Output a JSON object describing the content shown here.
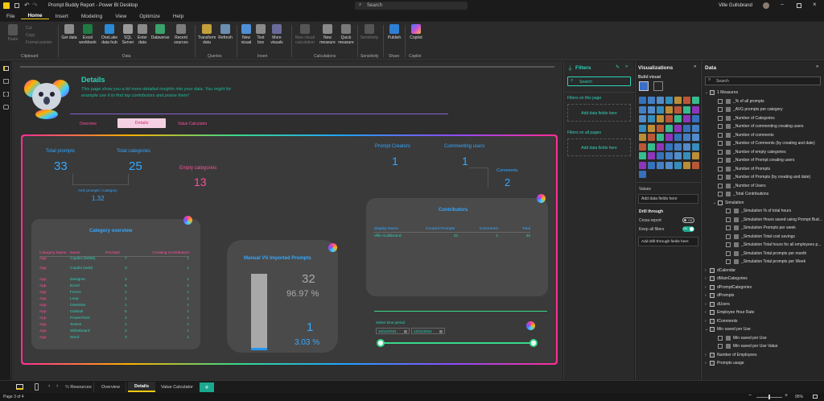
{
  "titlebar": {
    "title": "Prompt Buddy Report - Power BI Desktop",
    "search": "Search",
    "user": "Ville Gullsbrand"
  },
  "menu": [
    "File",
    "Home",
    "Insert",
    "Modeling",
    "View",
    "Optimize",
    "Help"
  ],
  "ribbon": {
    "clipboard": {
      "paste": "Paste",
      "cut": "Cut",
      "copy": "Copy",
      "format_painter": "Format painter",
      "label": "Clipboard"
    },
    "data": {
      "buttons": [
        "Get data",
        "Excel workbook",
        "OneLake data hub",
        "SQL Server",
        "Enter data",
        "Dataverse",
        "Recent sources"
      ],
      "label": "Data"
    },
    "queries": {
      "buttons": [
        "Transform data",
        "Refresh"
      ],
      "label": "Queries"
    },
    "insert": {
      "buttons": [
        "New visual",
        "Text box",
        "More visuals"
      ],
      "label": "Insert"
    },
    "calculations": {
      "buttons": [
        "New visual calculation",
        "New measure",
        "Quick measure"
      ],
      "label": "Calculations"
    },
    "sensitivity": {
      "buttons": [
        "Sensitivity"
      ],
      "label": "Sensitivity"
    },
    "share": {
      "buttons": [
        "Publish"
      ],
      "label": "Share"
    },
    "copilot": {
      "buttons": [
        "Copilot"
      ],
      "label": "Copilot"
    }
  },
  "report": {
    "title": "Details",
    "subtitle": "This page show you a bit more detailed insights into your data. You might for example use it to find top contributors and praise them!",
    "nav": [
      "Overview",
      "Details",
      "Value Calculator"
    ],
    "kpis": {
      "total_prompts_label": "Total prompts",
      "total_prompts": "33",
      "total_categories_label": "Total categories",
      "total_categories": "25",
      "empty_categories_label": "Empty categories",
      "empty_categories": "13",
      "avg_label": "AVG prompts / Category",
      "avg": "1.32",
      "prompt_creators_label": "Prompt Creators",
      "prompt_creators": "1",
      "commenting_users_label": "Commenting users",
      "commenting_users": "1",
      "comments_label": "Comments",
      "comments": "2"
    },
    "category_overview": {
      "title": "Category overview",
      "headers": [
        "Category Name",
        "Name",
        "Prompts",
        "Creating Contributors"
      ],
      "rows": [
        [
          "App",
          "Copilot (M365)",
          "7",
          "1"
        ],
        [
          "App",
          "Copilot (web)",
          "3",
          "1"
        ],
        [
          "App",
          "Designer",
          "2",
          "1"
        ],
        [
          "App",
          "Excel",
          "5",
          "1"
        ],
        [
          "App",
          "Forms",
          "1",
          "1"
        ],
        [
          "App",
          "Loop",
          "1",
          "1"
        ],
        [
          "App",
          "OneNote",
          "1",
          "1"
        ],
        [
          "App",
          "Outlook",
          "5",
          "1"
        ],
        [
          "App",
          "PowerPoint",
          "2",
          "1"
        ],
        [
          "App",
          "Teams",
          "1",
          "1"
        ],
        [
          "App",
          "Whiteboard",
          "2",
          "1"
        ],
        [
          "App",
          "Word",
          "3",
          "1"
        ]
      ]
    },
    "manual_vs_imported": {
      "title": "Manual VS Imported Prompts",
      "manual_count": "32",
      "manual_pct": "96.97 %",
      "imported_count": "1",
      "imported_pct": "3.03 %",
      "imported_fraction": 0.0303
    },
    "contributors": {
      "title": "Contributors",
      "headers": [
        "Display Name",
        "Created Prompts",
        "Comments",
        "Total"
      ],
      "rows": [
        [
          "Ville Gullsbrand",
          "33",
          "2",
          "35"
        ]
      ]
    },
    "time_period": {
      "label": "Select time period",
      "start": "10/24/2024",
      "end": "12/31/2024"
    }
  },
  "filters": {
    "title": "Filters",
    "search": "Search",
    "on_page": "Filters on this page",
    "add_fields": "Add data fields here",
    "on_all_pages": "Filters on all pages"
  },
  "visualizations": {
    "title": "Visualizations",
    "build": "Build visual",
    "values": "Values",
    "add_fields": "Add data fields here",
    "drill": "Drill through",
    "cross_report": "Cross-report",
    "cross_state": "Off",
    "keep_filters": "Keep all filters",
    "keep_state": "On",
    "add_drill": "Add drill-through fields here"
  },
  "data_pane": {
    "title": "Data",
    "search": "Search",
    "items": [
      {
        "t": "1 Measures",
        "lvl": 0,
        "kind": "table"
      },
      {
        "t": "_% of all prompts",
        "lvl": 1,
        "kind": "field"
      },
      {
        "t": "_AVG prompts per category",
        "lvl": 1,
        "kind": "field"
      },
      {
        "t": "_Number of Categories",
        "lvl": 1,
        "kind": "field"
      },
      {
        "t": "_Number of commenting creating users",
        "lvl": 1,
        "kind": "field"
      },
      {
        "t": "_Number of comments",
        "lvl": 1,
        "kind": "field"
      },
      {
        "t": "_Number of Comments (by creating and date)",
        "lvl": 1,
        "kind": "field"
      },
      {
        "t": "_Number of empty categories",
        "lvl": 1,
        "kind": "field"
      },
      {
        "t": "_Number of Prompt creating users",
        "lvl": 1,
        "kind": "field"
      },
      {
        "t": "_Number of Prompts",
        "lvl": 1,
        "kind": "field"
      },
      {
        "t": "_Number of Prompts (by creating and date)",
        "lvl": 1,
        "kind": "field"
      },
      {
        "t": "_Number of Users",
        "lvl": 1,
        "kind": "field"
      },
      {
        "t": "_Total Contributions",
        "lvl": 1,
        "kind": "field"
      },
      {
        "t": "Simulation",
        "lvl": 1,
        "kind": "folder"
      },
      {
        "t": "_Simulation % of total hours",
        "lvl": 2,
        "kind": "field"
      },
      {
        "t": "_Simulation Hours saved using Prompt Bud...",
        "lvl": 2,
        "kind": "field"
      },
      {
        "t": "_Simulation Prompts per week",
        "lvl": 2,
        "kind": "field"
      },
      {
        "t": "_Simulation Total cost savings",
        "lvl": 2,
        "kind": "field"
      },
      {
        "t": "_Simulation Total hours for all employees p...",
        "lvl": 2,
        "kind": "field"
      },
      {
        "t": "_Simulation Total prompts per month",
        "lvl": 2,
        "kind": "field"
      },
      {
        "t": "_Simulation Total prompts per Week",
        "lvl": 2,
        "kind": "field"
      },
      {
        "t": "dCalendar",
        "lvl": 0,
        "kind": "table-c"
      },
      {
        "t": "dMainCategories",
        "lvl": 0,
        "kind": "table-c"
      },
      {
        "t": "dPromptCategories",
        "lvl": 0,
        "kind": "table-c"
      },
      {
        "t": "dPrompts",
        "lvl": 0,
        "kind": "table-c"
      },
      {
        "t": "dUsers",
        "lvl": 0,
        "kind": "table-c"
      },
      {
        "t": "Employee Hour Rate",
        "lvl": 0,
        "kind": "table-c"
      },
      {
        "t": "fComments",
        "lvl": 0,
        "kind": "table-c"
      },
      {
        "t": "Min saved per Use",
        "lvl": 0,
        "kind": "table"
      },
      {
        "t": "Min saved per Use",
        "lvl": 1,
        "kind": "field"
      },
      {
        "t": "Min saved per Use Value",
        "lvl": 1,
        "kind": "field"
      },
      {
        "t": "Number of Employees",
        "lvl": 0,
        "kind": "table-c"
      },
      {
        "t": "Prompts usage",
        "lvl": 0,
        "kind": "table-c"
      }
    ]
  },
  "tabs": {
    "pages": [
      "Resources",
      "Overview",
      "Details",
      "Value Calculator"
    ],
    "active": "Details",
    "add": "+"
  },
  "status": {
    "page": "Page 3 of 4",
    "zoom": "95%"
  }
}
